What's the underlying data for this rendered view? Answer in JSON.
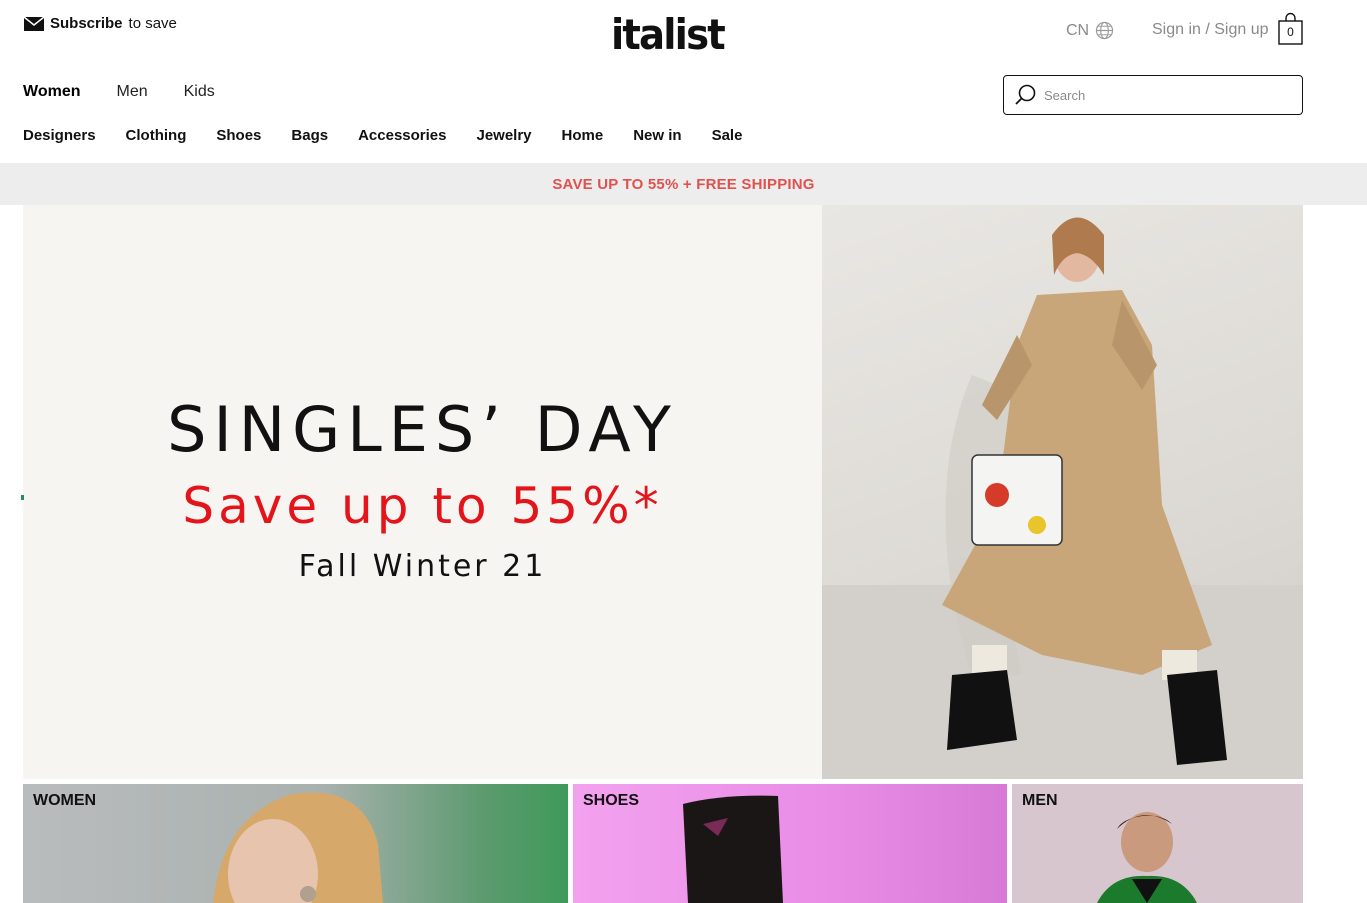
{
  "header": {
    "subscribe_bold": "Subscribe",
    "subscribe_rest": "to save",
    "logo": "italist",
    "region": "CN",
    "signin": "Sign in / Sign up",
    "bag_count": "0"
  },
  "gender_nav": [
    "Women",
    "Men",
    "Kids"
  ],
  "search": {
    "placeholder": "Search"
  },
  "category_nav": [
    "Designers",
    "Clothing",
    "Shoes",
    "Bags",
    "Accessories",
    "Jewelry",
    "Home",
    "New in",
    "Sale"
  ],
  "promo": {
    "text": "SAVE UP TO 55% + FREE SHIPPING",
    "color": "#e0524f"
  },
  "hero": {
    "title": "SINGLES’ DAY",
    "subtitle": "Save up to 55%*",
    "season": "Fall Winter 21",
    "subtitle_color": "#e4141b"
  },
  "tiles": [
    {
      "label": "WOMEN"
    },
    {
      "label": "SHOES"
    },
    {
      "label": "MEN"
    }
  ]
}
